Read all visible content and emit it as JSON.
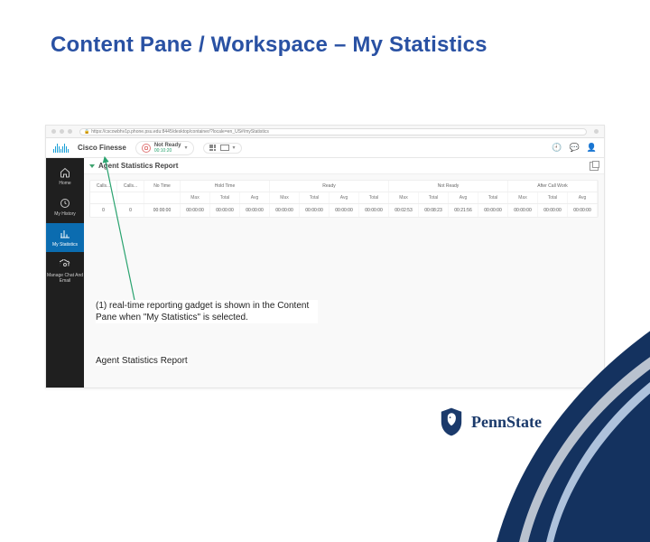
{
  "slide": {
    "title": "Content Pane / Workspace – My Statistics"
  },
  "browser": {
    "url": "https://cscowbhv1p.phone.psu.edu:8445/desktop/container/?locale=en_US#/myStatistics"
  },
  "finesse": {
    "brand": "Cisco Finesse",
    "status_label": "Not Ready",
    "status_time": "00:10:20"
  },
  "sidebar": {
    "items": [
      {
        "label": "Home"
      },
      {
        "label": "My History"
      },
      {
        "label": "My Statistics"
      },
      {
        "label": "Manage Chat And Email"
      }
    ]
  },
  "report": {
    "title": "Agent Statistics Report",
    "groups": {
      "calls_handled": "Calls...",
      "calls_ans": "Calls...",
      "no_time": "No Time",
      "hold": "Hold Time",
      "ready": "Ready",
      "not_ready": "Not Ready",
      "acw": "After Call Work"
    },
    "cols": {
      "max": "Max",
      "total": "Total",
      "avg": "Avg"
    },
    "row": {
      "calls_h": "0",
      "calls_a": "0",
      "no_time": "00:00:00",
      "hold_max": "00:00:00",
      "hold_total": "00:00:00",
      "hold_avg": "00:00:00",
      "ready_max": "00:00:00",
      "ready_total": "00:00:00",
      "ready_avg": "00:00:00",
      "ready_total2": "00:00:00",
      "nr_max": "00:02:53",
      "nr_total": "00:08:23",
      "nr_avg": "00:21:56",
      "nr_total2": "00:00:00",
      "acw_max": "00:00:00",
      "acw_total": "00:00:00",
      "acw_avg": "00:00:00"
    }
  },
  "captions": {
    "line1": "(1) real-time reporting gadget is shown in the Content Pane when \"My Statistics\" is selected.",
    "line2": "Agent Statistics Report"
  },
  "footer": {
    "brand": "PennState"
  }
}
